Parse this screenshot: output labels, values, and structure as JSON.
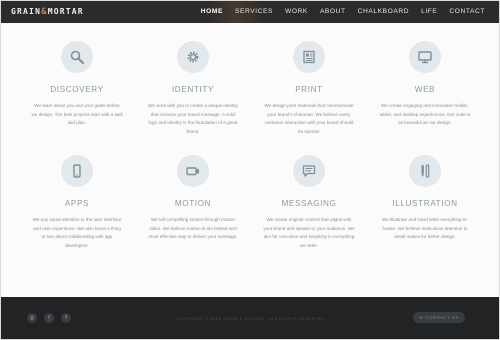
{
  "header": {
    "logo": {
      "left": "GRAIN",
      "amp": "&",
      "right": "MORTAR"
    },
    "nav": [
      {
        "label": "HOME",
        "active": true
      },
      {
        "label": "SERVICES",
        "active": false
      },
      {
        "label": "WORK",
        "active": false
      },
      {
        "label": "ABOUT",
        "active": false
      },
      {
        "label": "CHALKBOARD",
        "active": false
      },
      {
        "label": "LIFE",
        "active": false
      },
      {
        "label": "CONTACT",
        "active": false
      }
    ]
  },
  "services": [
    {
      "title": "DISCOVERY",
      "icon": "magnifier-icon",
      "text": "We learn about you and your goals before we design. The best projects start with a well laid plan."
    },
    {
      "title": "IDENTITY",
      "icon": "gear-icon",
      "text": "We work with you to create a unique identity that conveys your brand message. A solid logo and identity is the foundation of a great brand."
    },
    {
      "title": "PRINT",
      "icon": "newspaper-icon",
      "text": "We design print materials that communicate your brand's character. We believe every customer interaction with your brand should be special."
    },
    {
      "title": "WEB",
      "icon": "monitor-icon",
      "text": "We create engaging and innovative mobile, tablet, and desktop experiences. Our code is as beautiful as our design."
    },
    {
      "title": "APPS",
      "icon": "phone-icon",
      "text": "We pay equal attention to the user interface and user experience. We also know a thing or two about collaborating with app developers."
    },
    {
      "title": "MOTION",
      "icon": "camera-icon",
      "text": "We tell compelling stories through motion video. We believe motion is the fastest and most effective way to deliver your message."
    },
    {
      "title": "MESSAGING",
      "icon": "speech-bubble-icon",
      "text": "We create original content that aligns with your brand and speaks to your audience. We aim for concision and simplicity in everything we write."
    },
    {
      "title": "ILLUSTRATION",
      "icon": "brush-icon",
      "text": "We illustrate and hand letter everything in-house. We believe meticulous attention to detail makes for better design."
    }
  ],
  "footer": {
    "social": [
      {
        "icon": "instagram-icon",
        "glyph": "◎"
      },
      {
        "icon": "twitter-icon",
        "glyph": "t"
      },
      {
        "icon": "facebook-icon",
        "glyph": "f"
      }
    ],
    "copyright": "COPYRIGHT © 2014 GRAIN & MORTAR · ALL RIGHTS RESERVED",
    "contact_button": "CONTACT US"
  },
  "colors": {
    "topbar": "#2b2b2d",
    "footer": "#212325",
    "accent": "#c8893e",
    "icon_circle": "#e2e8ec",
    "heading": "#8a9aa3"
  }
}
